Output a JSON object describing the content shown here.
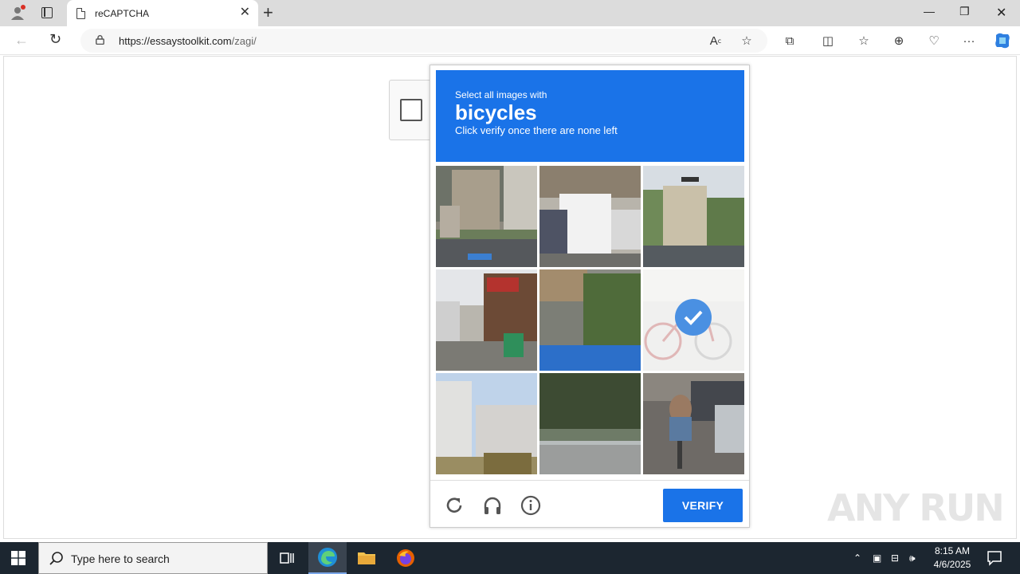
{
  "browser": {
    "tab_title": "reCAPTCHA",
    "url_host": "https://essaystoolkit.com",
    "url_path": "/zagi/"
  },
  "captcha": {
    "instruction_line1": "Select all images with",
    "target": "bicycles",
    "instruction_line3": "Click verify once there are none left",
    "verify_label": "VERIFY",
    "accent_color": "#1a73e8",
    "tiles": [
      {
        "row": 1,
        "col": 1,
        "selected": false
      },
      {
        "row": 1,
        "col": 2,
        "selected": false
      },
      {
        "row": 1,
        "col": 3,
        "selected": false
      },
      {
        "row": 2,
        "col": 1,
        "selected": false
      },
      {
        "row": 2,
        "col": 2,
        "selected": false
      },
      {
        "row": 2,
        "col": 3,
        "selected": true
      },
      {
        "row": 3,
        "col": 1,
        "selected": false
      },
      {
        "row": 3,
        "col": 2,
        "selected": false
      },
      {
        "row": 3,
        "col": 3,
        "selected": false
      }
    ],
    "footer_icons": [
      "reload-icon",
      "headphones-icon",
      "info-icon"
    ]
  },
  "watermark": "ANY RUN",
  "taskbar": {
    "search_placeholder": "Type here to search",
    "time": "8:15 AM",
    "date": "4/6/2025"
  }
}
